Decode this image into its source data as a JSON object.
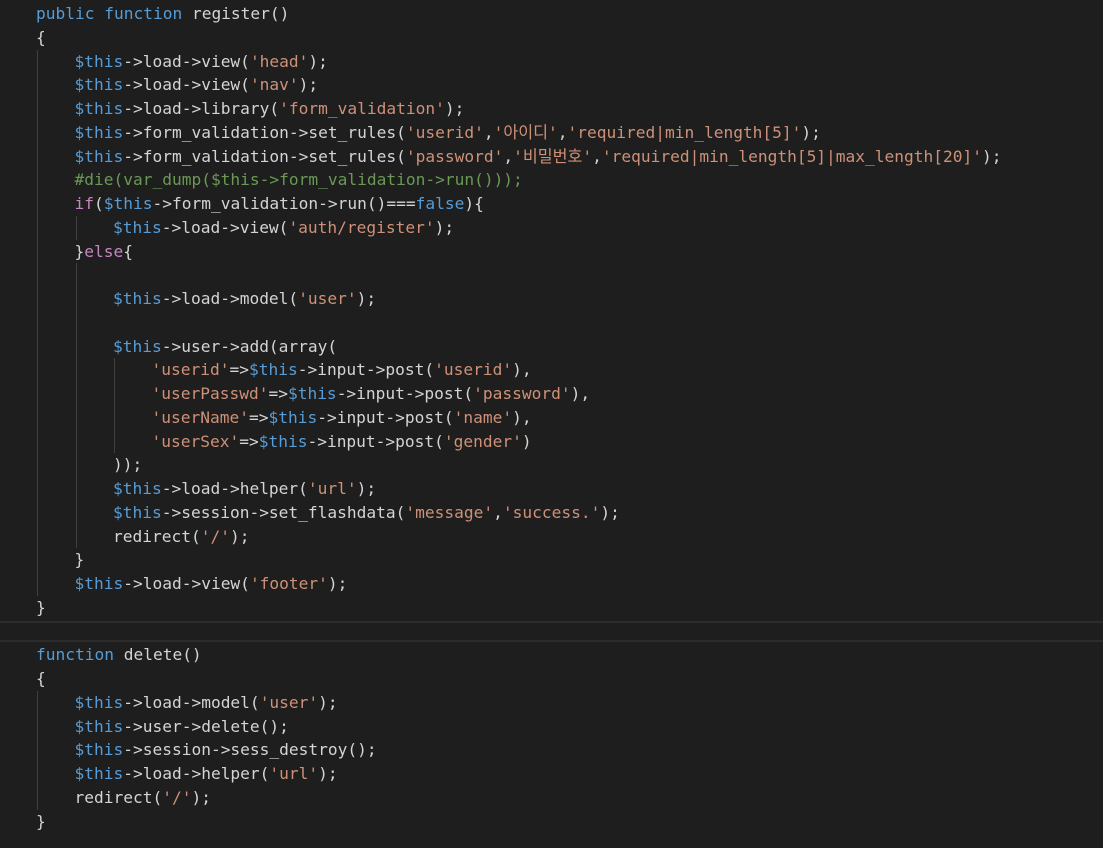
{
  "editor": {
    "language": "php",
    "theme_colors": {
      "background": "#1e1e1e",
      "keyword": "#569cd6",
      "function": "#dcdcaa",
      "string": "#ce9178",
      "comment": "#6a9955",
      "variable": "#9cdcfe",
      "plain": "#d4d4d4"
    },
    "lines": [
      {
        "indent": 0,
        "tokens": [
          {
            "t": "public",
            "c": "kw"
          },
          {
            "t": " ",
            "c": "pl"
          },
          {
            "t": "function",
            "c": "kw"
          },
          {
            "t": " register()",
            "c": "pl"
          }
        ]
      },
      {
        "indent": 0,
        "tokens": [
          {
            "t": "{",
            "c": "pl"
          }
        ]
      },
      {
        "indent": 1,
        "tokens": [
          {
            "t": "$this",
            "c": "vr"
          },
          {
            "t": "->load->view(",
            "c": "pl"
          },
          {
            "t": "'head'",
            "c": "str"
          },
          {
            "t": ");",
            "c": "pl"
          }
        ]
      },
      {
        "indent": 1,
        "tokens": [
          {
            "t": "$this",
            "c": "vr"
          },
          {
            "t": "->load->view(",
            "c": "pl"
          },
          {
            "t": "'nav'",
            "c": "str"
          },
          {
            "t": ");",
            "c": "pl"
          }
        ]
      },
      {
        "indent": 1,
        "tokens": [
          {
            "t": "$this",
            "c": "vr"
          },
          {
            "t": "->load->library(",
            "c": "pl"
          },
          {
            "t": "'form_validation'",
            "c": "str"
          },
          {
            "t": ");",
            "c": "pl"
          }
        ]
      },
      {
        "indent": 1,
        "tokens": [
          {
            "t": "$this",
            "c": "vr"
          },
          {
            "t": "->form_validation->set_rules(",
            "c": "pl"
          },
          {
            "t": "'userid'",
            "c": "str"
          },
          {
            "t": ",",
            "c": "pl"
          },
          {
            "t": "'아이디'",
            "c": "str"
          },
          {
            "t": ",",
            "c": "pl"
          },
          {
            "t": "'required|min_length[5]'",
            "c": "str"
          },
          {
            "t": ");",
            "c": "pl"
          }
        ]
      },
      {
        "indent": 1,
        "tokens": [
          {
            "t": "$this",
            "c": "vr"
          },
          {
            "t": "->form_validation->set_rules(",
            "c": "pl"
          },
          {
            "t": "'password'",
            "c": "str"
          },
          {
            "t": ",",
            "c": "pl"
          },
          {
            "t": "'비밀번호'",
            "c": "str"
          },
          {
            "t": ",",
            "c": "pl"
          },
          {
            "t": "'required|min_length[5]|max_length[20]'",
            "c": "str"
          },
          {
            "t": ");",
            "c": "pl"
          }
        ]
      },
      {
        "indent": 1,
        "tokens": [
          {
            "t": "#die(var_dump($this->form_validation->run()));",
            "c": "cm"
          }
        ]
      },
      {
        "indent": 1,
        "tokens": [
          {
            "t": "if",
            "c": "ctl"
          },
          {
            "t": "(",
            "c": "pl"
          },
          {
            "t": "$this",
            "c": "vr"
          },
          {
            "t": "->form_validation->run()===",
            "c": "pl"
          },
          {
            "t": "false",
            "c": "kw"
          },
          {
            "t": "){",
            "c": "pl"
          }
        ]
      },
      {
        "indent": 2,
        "tokens": [
          {
            "t": "$this",
            "c": "vr"
          },
          {
            "t": "->load->view(",
            "c": "pl"
          },
          {
            "t": "'auth/register'",
            "c": "str"
          },
          {
            "t": ");",
            "c": "pl"
          }
        ]
      },
      {
        "indent": 1,
        "tokens": [
          {
            "t": "}",
            "c": "pl"
          },
          {
            "t": "else",
            "c": "ctl"
          },
          {
            "t": "{",
            "c": "pl"
          }
        ]
      },
      {
        "indent": 0,
        "tokens": []
      },
      {
        "indent": 2,
        "tokens": [
          {
            "t": "$this",
            "c": "vr"
          },
          {
            "t": "->load->model(",
            "c": "pl"
          },
          {
            "t": "'user'",
            "c": "str"
          },
          {
            "t": ");",
            "c": "pl"
          }
        ]
      },
      {
        "indent": 0,
        "tokens": []
      },
      {
        "indent": 2,
        "tokens": [
          {
            "t": "$this",
            "c": "vr"
          },
          {
            "t": "->user->add(array(",
            "c": "pl"
          }
        ]
      },
      {
        "indent": 3,
        "tokens": [
          {
            "t": "'userid'",
            "c": "str"
          },
          {
            "t": "=>",
            "c": "pl"
          },
          {
            "t": "$this",
            "c": "vr"
          },
          {
            "t": "->input->post(",
            "c": "pl"
          },
          {
            "t": "'userid'",
            "c": "str"
          },
          {
            "t": "),",
            "c": "pl"
          }
        ]
      },
      {
        "indent": 3,
        "tokens": [
          {
            "t": "'userPasswd'",
            "c": "str"
          },
          {
            "t": "=>",
            "c": "pl"
          },
          {
            "t": "$this",
            "c": "vr"
          },
          {
            "t": "->input->post(",
            "c": "pl"
          },
          {
            "t": "'password'",
            "c": "str"
          },
          {
            "t": "),",
            "c": "pl"
          }
        ]
      },
      {
        "indent": 3,
        "tokens": [
          {
            "t": "'userName'",
            "c": "str"
          },
          {
            "t": "=>",
            "c": "pl"
          },
          {
            "t": "$this",
            "c": "vr"
          },
          {
            "t": "->input->post(",
            "c": "pl"
          },
          {
            "t": "'name'",
            "c": "str"
          },
          {
            "t": "),",
            "c": "pl"
          }
        ]
      },
      {
        "indent": 3,
        "tokens": [
          {
            "t": "'userSex'",
            "c": "str"
          },
          {
            "t": "=>",
            "c": "pl"
          },
          {
            "t": "$this",
            "c": "vr"
          },
          {
            "t": "->input->post(",
            "c": "pl"
          },
          {
            "t": "'gender'",
            "c": "str"
          },
          {
            "t": ")",
            "c": "pl"
          }
        ]
      },
      {
        "indent": 2,
        "tokens": [
          {
            "t": "));",
            "c": "pl"
          }
        ]
      },
      {
        "indent": 2,
        "tokens": [
          {
            "t": "$this",
            "c": "vr"
          },
          {
            "t": "->load->helper(",
            "c": "pl"
          },
          {
            "t": "'url'",
            "c": "str"
          },
          {
            "t": ");",
            "c": "pl"
          }
        ]
      },
      {
        "indent": 2,
        "tokens": [
          {
            "t": "$this",
            "c": "vr"
          },
          {
            "t": "->session->set_flashdata(",
            "c": "pl"
          },
          {
            "t": "'message'",
            "c": "str"
          },
          {
            "t": ",",
            "c": "pl"
          },
          {
            "t": "'success.'",
            "c": "str"
          },
          {
            "t": ");",
            "c": "pl"
          }
        ]
      },
      {
        "indent": 2,
        "tokens": [
          {
            "t": "redirect(",
            "c": "pl"
          },
          {
            "t": "'/'",
            "c": "str"
          },
          {
            "t": ");",
            "c": "pl"
          }
        ]
      },
      {
        "indent": 1,
        "tokens": [
          {
            "t": "}",
            "c": "pl"
          }
        ]
      },
      {
        "indent": 1,
        "tokens": [
          {
            "t": "$this",
            "c": "vr"
          },
          {
            "t": "->load->view(",
            "c": "pl"
          },
          {
            "t": "'footer'",
            "c": "str"
          },
          {
            "t": ");",
            "c": "pl"
          }
        ]
      },
      {
        "indent": 0,
        "tokens": [
          {
            "t": "}",
            "c": "pl"
          }
        ]
      },
      {
        "indent": 0,
        "tokens": []
      },
      {
        "indent": 0,
        "tokens": [
          {
            "t": "function",
            "c": "kw"
          },
          {
            "t": " delete()",
            "c": "pl"
          }
        ]
      },
      {
        "indent": 0,
        "tokens": [
          {
            "t": "{",
            "c": "pl"
          }
        ]
      },
      {
        "indent": 1,
        "tokens": [
          {
            "t": "$this",
            "c": "vr"
          },
          {
            "t": "->load->model(",
            "c": "pl"
          },
          {
            "t": "'user'",
            "c": "str"
          },
          {
            "t": ");",
            "c": "pl"
          }
        ]
      },
      {
        "indent": 1,
        "tokens": [
          {
            "t": "$this",
            "c": "vr"
          },
          {
            "t": "->user->delete();",
            "c": "pl"
          }
        ]
      },
      {
        "indent": 1,
        "tokens": [
          {
            "t": "$this",
            "c": "vr"
          },
          {
            "t": "->session->sess_destroy();",
            "c": "pl"
          }
        ]
      },
      {
        "indent": 1,
        "tokens": [
          {
            "t": "$this",
            "c": "vr"
          },
          {
            "t": "->load->helper(",
            "c": "pl"
          },
          {
            "t": "'url'",
            "c": "str"
          },
          {
            "t": ");",
            "c": "pl"
          }
        ]
      },
      {
        "indent": 1,
        "tokens": [
          {
            "t": "redirect(",
            "c": "pl"
          },
          {
            "t": "'/'",
            "c": "str"
          },
          {
            "t": ");",
            "c": "pl"
          }
        ]
      },
      {
        "indent": 0,
        "tokens": [
          {
            "t": "}",
            "c": "pl"
          }
        ]
      }
    ]
  }
}
